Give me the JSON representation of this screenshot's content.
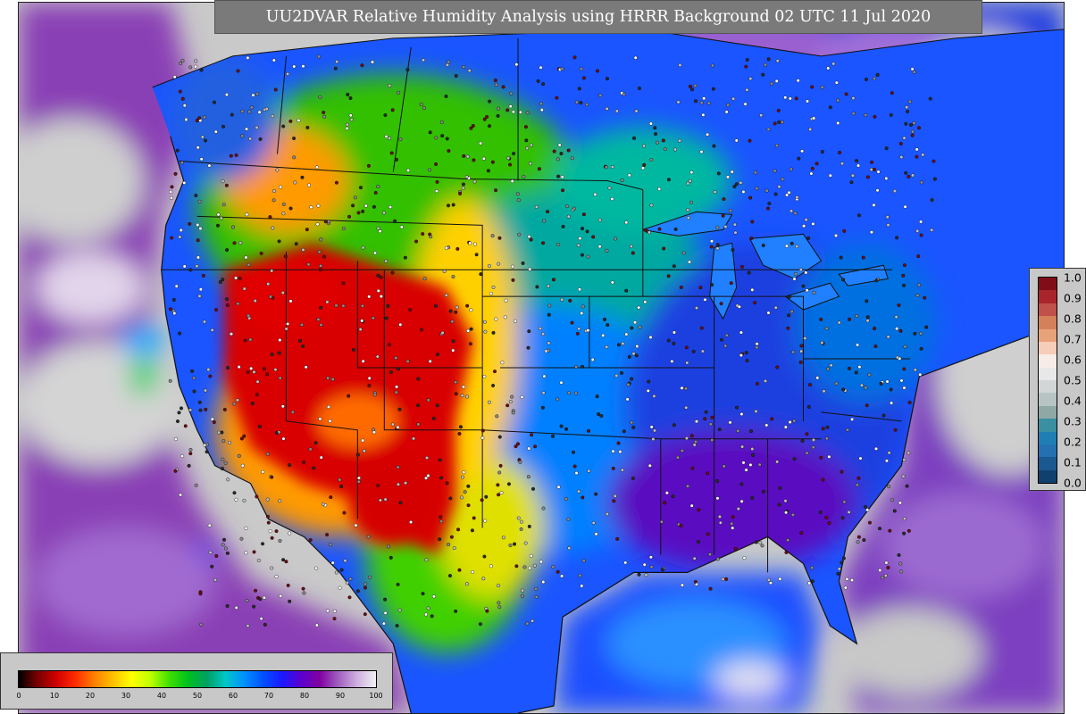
{
  "title": "UU2DVAR Relative Humidity Analysis using HRRR Background 02 UTC 11 Jul 2020",
  "bottom_colorbar": {
    "ticks": [
      "0",
      "10",
      "20",
      "30",
      "40",
      "50",
      "60",
      "70",
      "80",
      "90",
      "100"
    ],
    "colors": [
      "#000000",
      "#7a0000",
      "#d00000",
      "#ff2a00",
      "#ff7f00",
      "#ffbf00",
      "#ffff00",
      "#bfff00",
      "#40e000",
      "#00c020",
      "#00a060",
      "#00c8c8",
      "#0090ff",
      "#0050ff",
      "#1a1aff",
      "#5a00d0",
      "#8000a0",
      "#a060c0",
      "#d0b0e0",
      "#f0f0f0"
    ]
  },
  "right_colorbar": {
    "ticks": [
      "1.0",
      "0.9",
      "0.8",
      "0.7",
      "0.6",
      "0.5",
      "0.4",
      "0.3",
      "0.2",
      "0.1",
      "0.0"
    ],
    "colors": [
      "#800d17",
      "#a8262b",
      "#c0504a",
      "#d4805a",
      "#e8a27a",
      "#f5cdb8",
      "#f7ece8",
      "#e8e8e8",
      "#d2d6d6",
      "#b8c4c4",
      "#8fa8a6",
      "#3a8fa0",
      "#1f7fb4",
      "#2470b0",
      "#1a5890",
      "#10406e"
    ]
  },
  "map": {
    "colors": {
      "ocean_grey": "#c9c9c9",
      "ocean_purple": "#8a3fb5",
      "dry_red": "#d80000",
      "orange": "#ff8a00",
      "yellow": "#f7e000",
      "green": "#2cc000",
      "teal": "#00a8a0",
      "blue": "#1060ff",
      "navy": "#2030d0",
      "violet": "#6a10c0",
      "boundary": "#111111"
    }
  }
}
